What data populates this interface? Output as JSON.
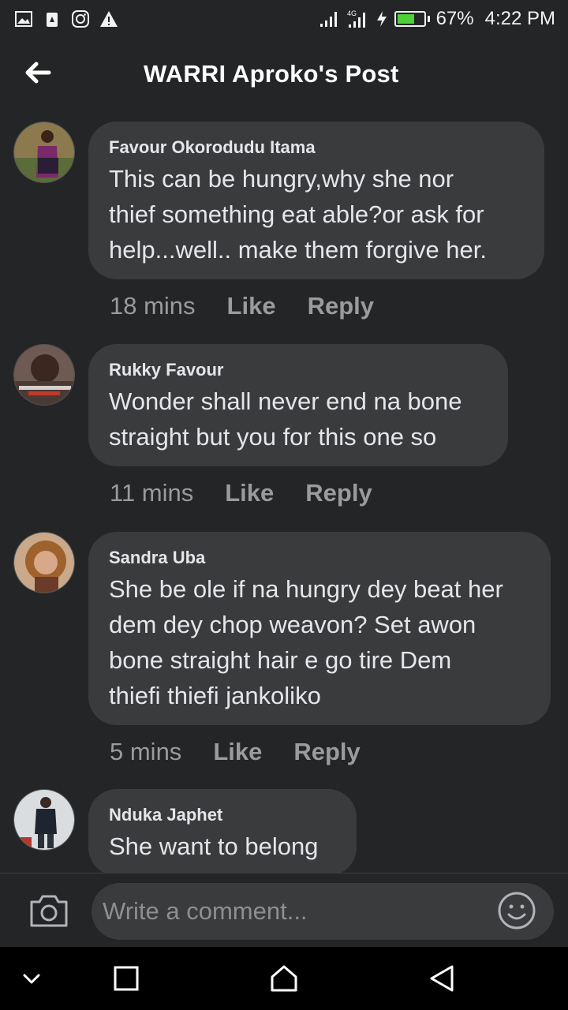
{
  "status_bar": {
    "battery_percent": "67%",
    "battery_level": 0.67,
    "time": "4:22 PM",
    "left_icons": [
      "image-icon",
      "lock-icon",
      "instagram-icon",
      "warning-icon"
    ],
    "right_icons": [
      "signal-icon",
      "signal-4g-icon",
      "charging-icon",
      "battery-icon"
    ],
    "battery_color": "#4cd137"
  },
  "header": {
    "title": "WARRI Aproko's Post",
    "back_icon": "arrow-left-icon"
  },
  "comments": [
    {
      "author": "Favour Okorodudu Itama",
      "lines": [
        "This can be hungry,why she nor",
        "thief something eat able?or ask for",
        "help...well.. make them forgive her."
      ],
      "time": "18 mins",
      "like": "Like",
      "reply": "Reply"
    },
    {
      "author": "Rukky Favour",
      "lines": [
        "Wonder shall never end na bone",
        "straight but you for this one so"
      ],
      "time": "11 mins",
      "like": "Like",
      "reply": "Reply"
    },
    {
      "author": "Sandra Uba",
      "lines": [
        "She be ole if na hungry dey beat her",
        "dem dey chop weavon? Set awon",
        "bone straight hair e go tire Dem",
        "thiefi thiefi jankoliko"
      ],
      "time": "5 mins",
      "like": "Like",
      "reply": "Reply"
    },
    {
      "author": "Nduka Japhet",
      "lines": [
        "She want to belong"
      ],
      "time": "",
      "like": "",
      "reply": ""
    }
  ],
  "composer": {
    "placeholder": "Write a comment...",
    "camera_icon": "camera-icon",
    "emoji_icon": "emoji-icon"
  },
  "nav_bar": {
    "icons": [
      "chevron-down-icon",
      "square-icon",
      "home-icon",
      "back-triangle-icon"
    ]
  }
}
